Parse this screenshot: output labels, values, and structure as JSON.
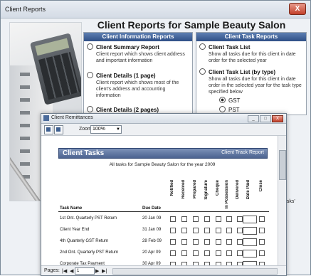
{
  "window": {
    "title": "Client Reports",
    "close_glyph": "X"
  },
  "main": {
    "title": "Client Reports for Sample Beauty Salon"
  },
  "left_panel": {
    "header": "Client Information Reports",
    "options": [
      {
        "label": "Client Summary Report",
        "desc": "Client report which shows client address and important information",
        "selected": false
      },
      {
        "label": "Client Details (1 page)",
        "desc": "Client report which shows most of the client's address and accounting information",
        "selected": false
      },
      {
        "label": "Client Details (2 pages)",
        "desc": "",
        "selected": false
      }
    ]
  },
  "right_panel": {
    "header": "Client Task Reports",
    "options": [
      {
        "label": "Client Task List",
        "desc": "Show all tasks due for this client in date order for the selected year",
        "selected": false
      },
      {
        "label": "Client Task List (by type)",
        "desc": "Show all tasks due for this client in date order in the selected year for the task type specified below",
        "selected": false
      }
    ],
    "sub_options": [
      {
        "label": "GST",
        "selected": true
      },
      {
        "label": "PST",
        "selected": false
      }
    ]
  },
  "partial_text": "asks'",
  "inner_window": {
    "title": "Client Remittances",
    "buttons": [
      "_",
      "□",
      "X"
    ],
    "zoom_label": "Zoom",
    "zoom_value": "100%",
    "zoom_arrow": "▼",
    "report": {
      "heading": "Client Tasks",
      "heading_right": "Client Track Report",
      "subtitle": "All tasks for Sample Beauty Salon for the year 2009",
      "col_task": "Task Name",
      "col_date": "Due Date",
      "status_cols": [
        "Notified",
        "Received",
        "Prepared",
        "Signature",
        "Cheque",
        "In Possession",
        "Delivered",
        "Date Paid",
        "Close"
      ],
      "rows": [
        {
          "name": "1st Ont. Quarterly PST Return",
          "date": "20 Jan 09"
        },
        {
          "name": "Client Year End",
          "date": "31 Jan 09"
        },
        {
          "name": "4th Quarterly GST Return",
          "date": "28 Feb 09"
        },
        {
          "name": "2nd Ont. Quarterly PST Return",
          "date": "20 Apr 09"
        },
        {
          "name": "Corporate Tax Payment",
          "date": "30 Apr 09"
        }
      ]
    },
    "pages_label": "Pages:",
    "page_value": "1",
    "nav_first": "|◀",
    "nav_prev": "◀",
    "nav_next": "▶",
    "nav_last": "▶|"
  }
}
